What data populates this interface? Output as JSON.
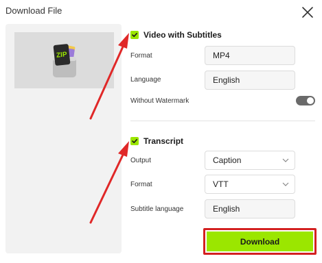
{
  "dialog": {
    "title": "Download File"
  },
  "preview": {
    "badge_text": "ZIP"
  },
  "video_section": {
    "title": "Video with Subtitles",
    "checked": true,
    "format_label": "Format",
    "format_value": "MP4",
    "language_label": "Language",
    "language_value": "English",
    "watermark_label": "Without Watermark",
    "watermark_on": true
  },
  "transcript_section": {
    "title": "Transcript",
    "checked": true,
    "output_label": "Output",
    "output_value": "Caption",
    "format_label": "Format",
    "format_value": "VTT",
    "subtitle_language_label": "Subtitle language",
    "subtitle_language_value": "English"
  },
  "actions": {
    "download_label": "Download"
  },
  "colors": {
    "accent_green": "#9be600",
    "highlight_red": "#d32020",
    "toggle_gray": "#6a6a6a"
  }
}
